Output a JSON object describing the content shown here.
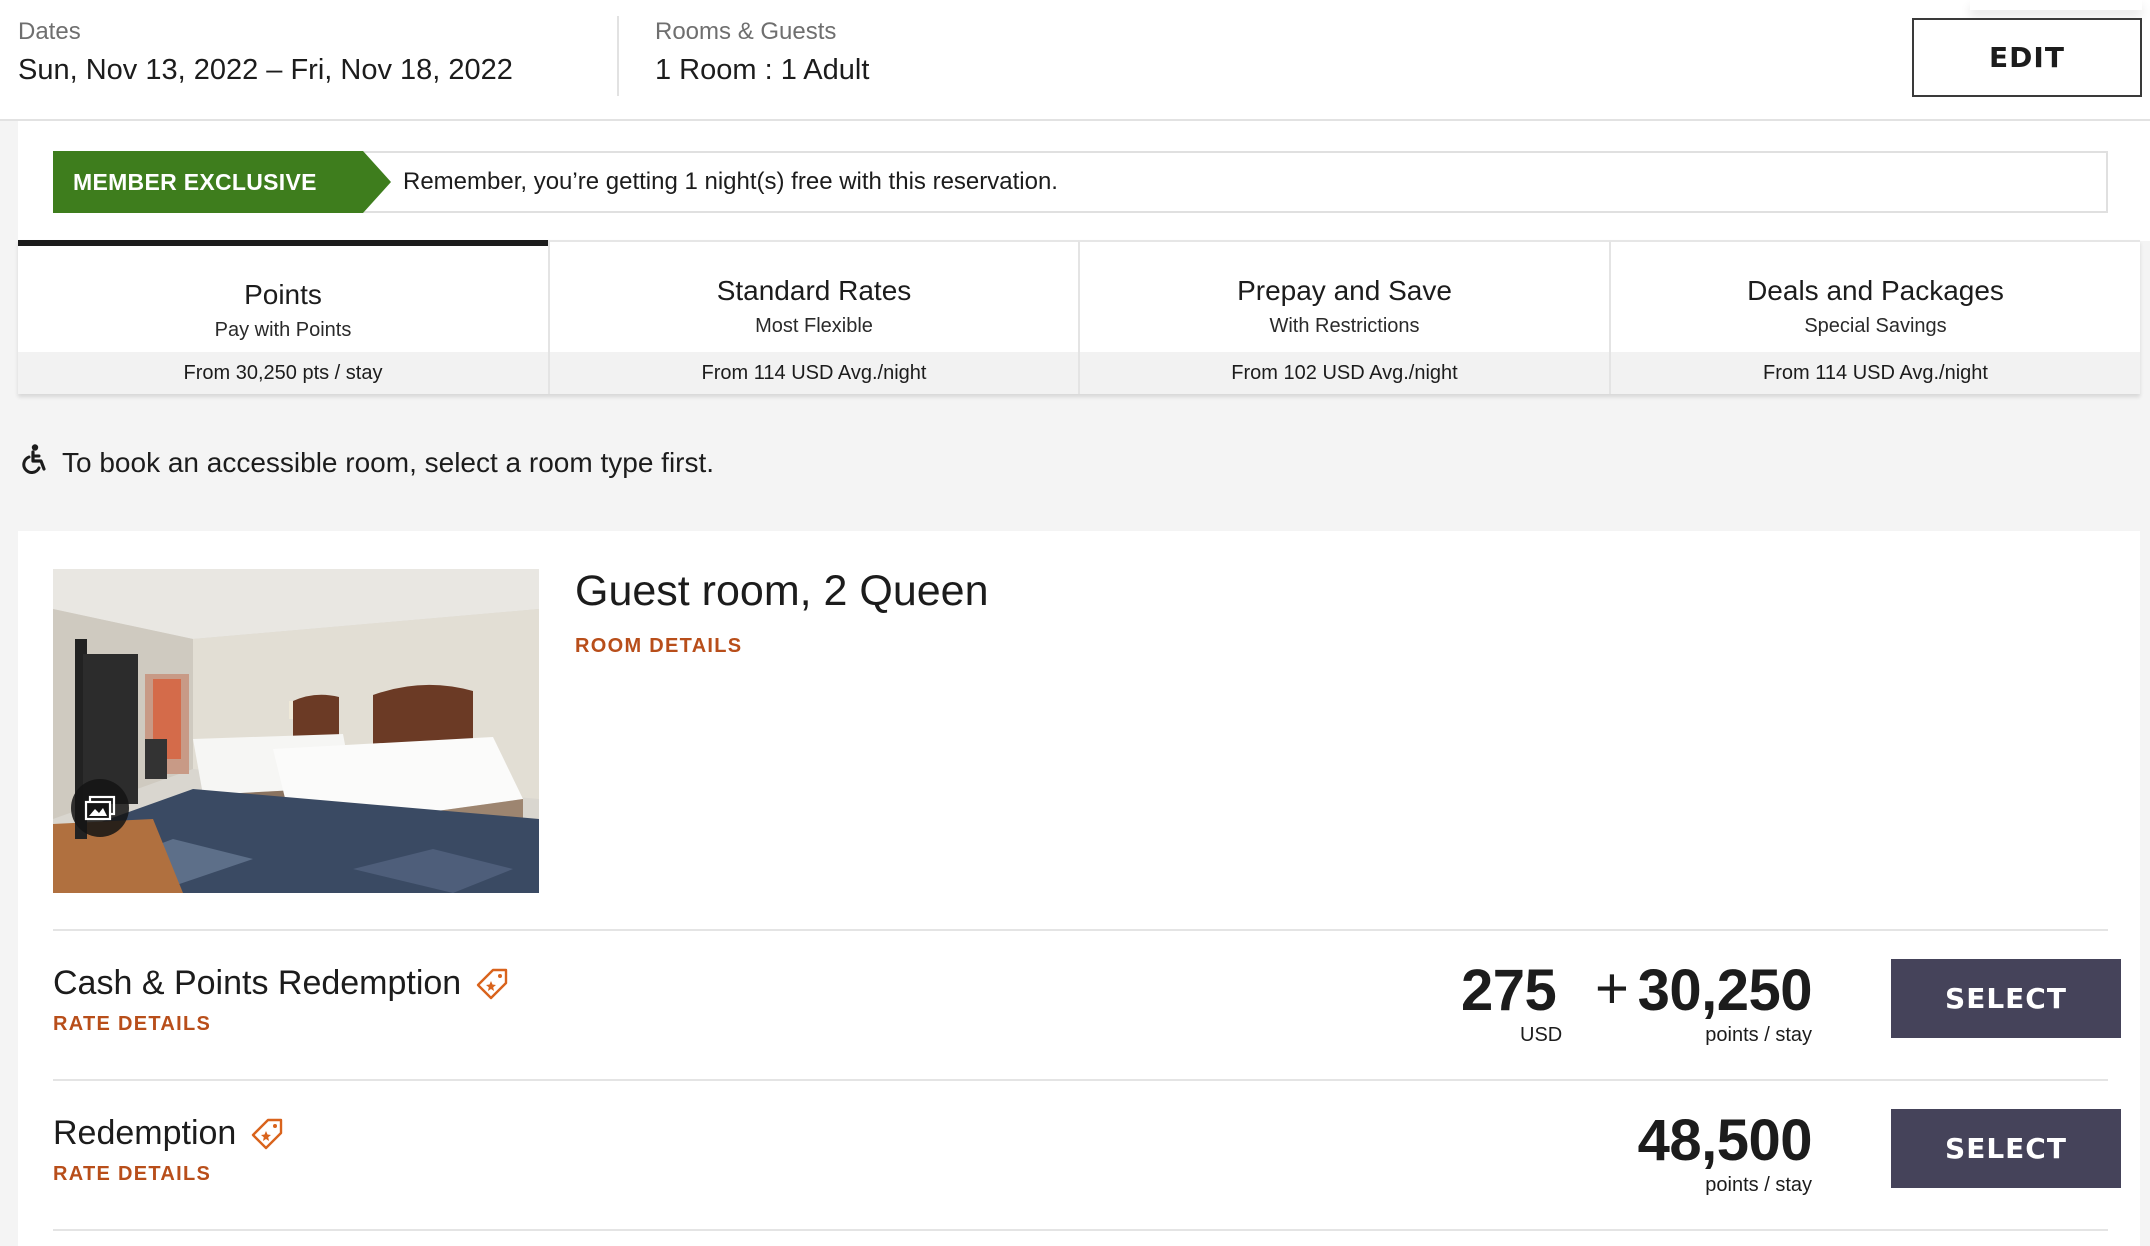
{
  "search": {
    "dates_label": "Dates",
    "dates_value": "Sun, Nov 13, 2022 – Fri, Nov 18, 2022",
    "guests_label": "Rooms & Guests",
    "guests_value": "1 Room : 1 Adult",
    "edit_label": "EDIT"
  },
  "banner": {
    "badge": "MEMBER EXCLUSIVE",
    "text": "Remember, you’re getting 1 night(s) free with this reservation.",
    "badge_color": "#3e7d1d"
  },
  "tabs": [
    {
      "title": "Points",
      "subtitle": "Pay with Points",
      "price": "From 30,250 pts / stay",
      "active": true
    },
    {
      "title": "Standard Rates",
      "subtitle": "Most Flexible",
      "price": "From 114 USD Avg./night",
      "active": false
    },
    {
      "title": "Prepay and Save",
      "subtitle": "With Restrictions",
      "price": "From 102 USD Avg./night",
      "active": false
    },
    {
      "title": "Deals and Packages",
      "subtitle": "Special Savings",
      "price": "From 114 USD Avg./night",
      "active": false
    }
  ],
  "accessibility": {
    "icon": "wheelchair-icon",
    "text": "To book an accessible room, select a room type first."
  },
  "room": {
    "title": "Guest room, 2 Queen",
    "details_link": "ROOM DETAILS",
    "photo_icon": "gallery-icon",
    "rates": [
      {
        "name": "Cash & Points Redemption",
        "details_link": "RATE DETAILS",
        "cash": "275",
        "plus": "+",
        "cash_unit": "USD",
        "points": "30,250",
        "points_unit": "points / stay",
        "select_label": "SELECT"
      },
      {
        "name": "Redemption",
        "details_link": "RATE DETAILS",
        "points": "48,500",
        "points_unit": "points / stay",
        "select_label": "SELECT"
      }
    ]
  },
  "colors": {
    "accent_link": "#b84e1a",
    "select_button": "#45435a",
    "background": "#f4f4f4"
  }
}
